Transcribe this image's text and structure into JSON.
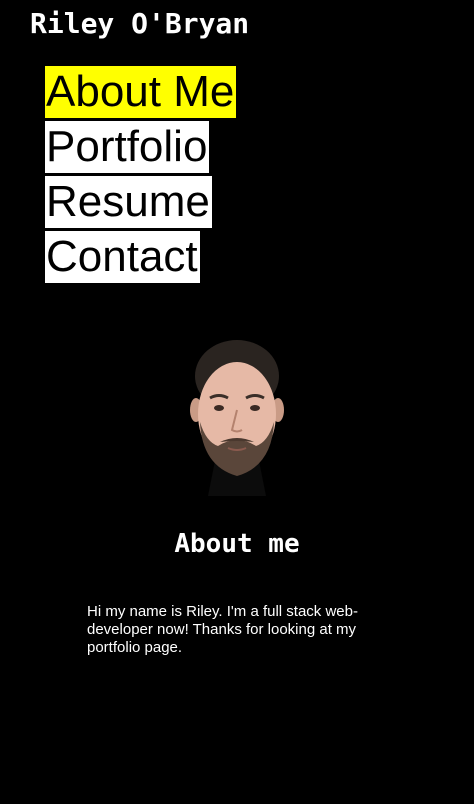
{
  "header": {
    "site_title": "Riley O'Bryan"
  },
  "nav": {
    "items": [
      {
        "label": "About Me",
        "active": true
      },
      {
        "label": "Portfolio",
        "active": false
      },
      {
        "label": "Resume",
        "active": false
      },
      {
        "label": "Contact",
        "active": false
      }
    ],
    "active_color": "#ffff00",
    "item_color": "#ffffff"
  },
  "main": {
    "profile_photo": "profile-photo",
    "section_heading": "About me",
    "bio": "Hi my name is Riley. I'm a full stack web-developer now! Thanks for looking at my portfolio page."
  },
  "colors": {
    "background": "#000000",
    "text": "#ffffff"
  }
}
